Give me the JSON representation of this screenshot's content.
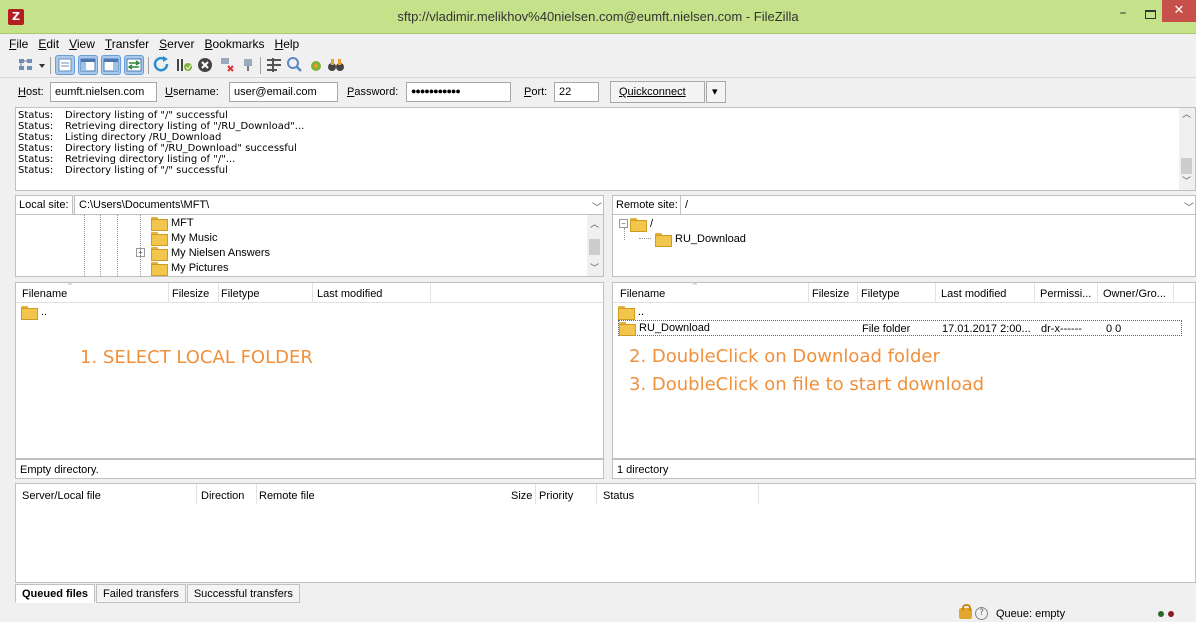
{
  "window": {
    "title": "sftp://vladimir.melikhov%40nielsen.com@eumft.nielsen.com - FileZilla",
    "app_icon_letter": "Z",
    "close_glyph": "✕",
    "minimize_glyph": "–"
  },
  "menu": [
    "File",
    "Edit",
    "View",
    "Transfer",
    "Server",
    "Bookmarks",
    "Help"
  ],
  "toolbar": {
    "buttons": [
      "site-manager-icon",
      "dropdown-arrow-icon",
      "toggle-log-icon",
      "toggle-local-tree-icon",
      "toggle-remote-tree-icon",
      "toggle-queue-icon",
      "refresh-icon",
      "process-queue-icon",
      "cancel-icon",
      "disconnect-icon",
      "reconnect-icon",
      "filter-icon",
      "compare-icon",
      "sync-browse-icon",
      "search-icon"
    ]
  },
  "quickconnect": {
    "host_label": "Host:",
    "host_value": "eumft.nielsen.com",
    "username_label": "Username:",
    "username_value": "user@email.com",
    "password_label": "Password:",
    "password_value": "●●●●●●●●●●●",
    "port_label": "Port:",
    "port_value": "22",
    "connect_label": "Quickconnect",
    "dropdown_glyph": "▾"
  },
  "log": [
    {
      "type": "Status:",
      "message": "Directory listing of \"/\" successful"
    },
    {
      "type": "Status:",
      "message": "Retrieving directory listing of \"/RU_Download\"..."
    },
    {
      "type": "Status:",
      "message": "Listing directory /RU_Download"
    },
    {
      "type": "Status:",
      "message": "Directory listing of \"/RU_Download\" successful"
    },
    {
      "type": "Status:",
      "message": "Retrieving directory listing of \"/\"..."
    },
    {
      "type": "Status:",
      "message": "Directory listing of \"/\" successful"
    }
  ],
  "local": {
    "site_label": "Local site:",
    "path": "C:\\Users\\Documents\\MFT\\",
    "tree": [
      "MFT",
      "My Music",
      "My Nielsen Answers",
      "My Pictures"
    ],
    "columns": [
      "Filename",
      "Filesize",
      "Filetype",
      "Last modified"
    ],
    "rows": [
      {
        "name": ".."
      }
    ],
    "status": "Empty directory.",
    "instruction": "1. SELECT LOCAL FOLDER"
  },
  "remote": {
    "site_label": "Remote site:",
    "path": "/",
    "tree": [
      "/",
      "RU_Download"
    ],
    "columns": [
      "Filename",
      "Filesize",
      "Filetype",
      "Last modified",
      "Permissi...",
      "Owner/Gro..."
    ],
    "rows": [
      {
        "name": "..",
        "filesize": "",
        "filetype": "",
        "modified": "",
        "permissions": "",
        "owner": ""
      },
      {
        "name": "RU_Download",
        "filesize": "",
        "filetype": "File folder",
        "modified": "17.01.2017 2:00...",
        "permissions": "dr-x------",
        "owner": "0 0"
      }
    ],
    "status": "1 directory",
    "instruction_2": "2. DoubleClick on Download folder",
    "instruction_3": "3. DoubleClick on file to start download"
  },
  "queue": {
    "columns": [
      "Server/Local file",
      "Direction",
      "Remote file",
      "Size",
      "Priority",
      "Status"
    ],
    "tabs": [
      "Queued files",
      "Failed transfers",
      "Successful transfers"
    ]
  },
  "statusbar": {
    "queue_text": "Queue: empty",
    "help_glyph": "?"
  },
  "colors": {
    "title_bar": "#c5e28b",
    "instruction_text": "#f0903c",
    "close_button": "#c7504a",
    "folder": "#f2c64d"
  }
}
